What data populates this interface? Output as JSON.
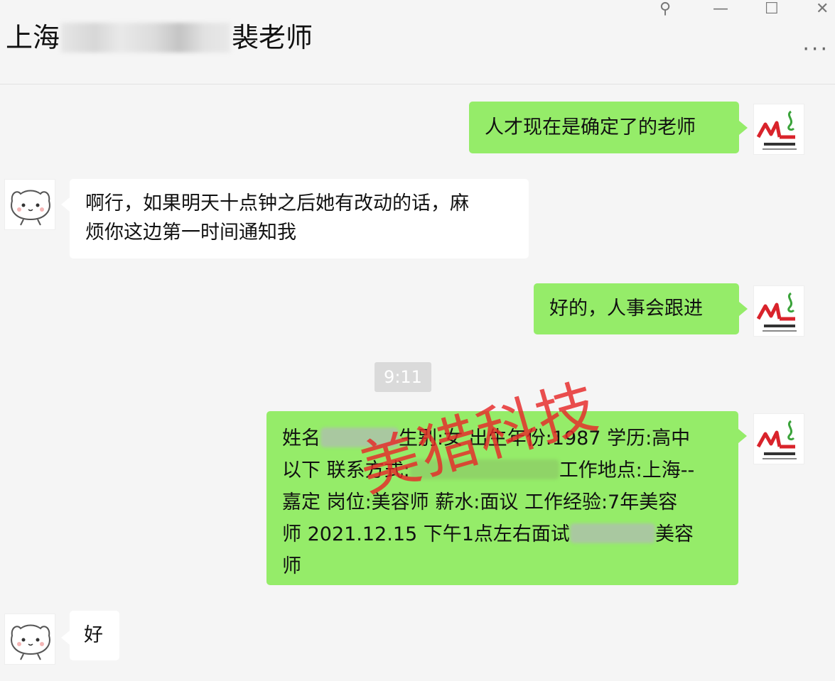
{
  "header": {
    "title_prefix": "上海",
    "title_suffix": "裴老师",
    "pin_icon": "pin-icon",
    "minimize_icon": "minimize-icon",
    "maximize_icon": "maximize-icon",
    "close_icon": "close-icon",
    "more_icon": "more-icon",
    "pin_glyph": "⚲",
    "minimize_glyph": "—",
    "maximize_glyph": "☐",
    "close_glyph": "✕",
    "more_glyph": "···"
  },
  "messages": [
    {
      "side": "right",
      "text": "人才现在是确定了的老师"
    },
    {
      "side": "left",
      "text_line1": "啊行，如果明天十点钟之后她有改动的话，麻",
      "text_line2": "烦你这边第一时间通知我"
    },
    {
      "side": "right",
      "text": "好的，人事会跟进"
    },
    {
      "side": "right",
      "line1_a": "姓名",
      "line1_b": "生别:女 出生年份:1987 学历:高中",
      "line2_a": "以下 联系方式:",
      "line2_b": "工作地点:上海--",
      "line3": "嘉定 岗位:美容师 薪水:面议 工作经验:7年美容",
      "line4_a": "师 2021.12.15 下午1点左右面试",
      "line4_b": "美容",
      "line5": "师"
    },
    {
      "side": "left",
      "text": "好"
    }
  ],
  "timestamp": "9:11",
  "watermark": "美猎科技",
  "avatar_logo_text": "ML",
  "colors": {
    "bubble_green": "#95ec69",
    "bubble_white": "#ffffff",
    "background": "#f5f5f5",
    "watermark": "#e62828",
    "logo_red": "#d9232b",
    "logo_green": "#3aa33a"
  }
}
